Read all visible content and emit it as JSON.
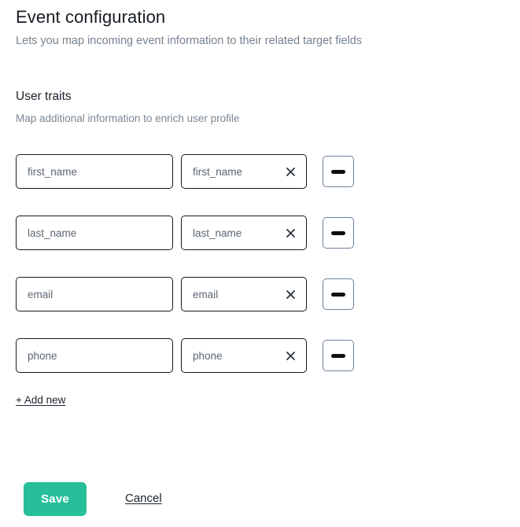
{
  "header": {
    "title": "Event configuration",
    "subtitle": "Lets you map incoming event information to their related target fields"
  },
  "section": {
    "title": "User traits",
    "subtitle": "Map additional information to enrich user profile"
  },
  "mappings": {
    "rows": [
      {
        "source_value": "first_name",
        "source_placeholder": "first_name",
        "target_value": "first_name",
        "target_placeholder": "first_name",
        "clear_icon": "close-icon",
        "remove_icon": "minus-icon"
      },
      {
        "source_value": "last_name",
        "source_placeholder": "last_name",
        "target_value": "last_name",
        "target_placeholder": "last_name",
        "clear_icon": "close-icon",
        "remove_icon": "minus-icon"
      },
      {
        "source_value": "email",
        "source_placeholder": "email",
        "target_value": "email",
        "target_placeholder": "email",
        "clear_icon": "close-icon",
        "remove_icon": "minus-icon"
      },
      {
        "source_value": "phone",
        "source_placeholder": "phone",
        "target_value": "phone",
        "target_placeholder": "phone",
        "clear_icon": "close-icon",
        "remove_icon": "minus-icon"
      }
    ],
    "add_new_label": "+ Add new"
  },
  "footer": {
    "save_label": "Save",
    "cancel_label": "Cancel"
  },
  "colors": {
    "accent": "#27bf99",
    "text_primary": "#17202a",
    "text_muted": "#7b8793",
    "field_text": "#5c6672",
    "field_border": "#15191d",
    "remove_border": "#6d819b"
  }
}
